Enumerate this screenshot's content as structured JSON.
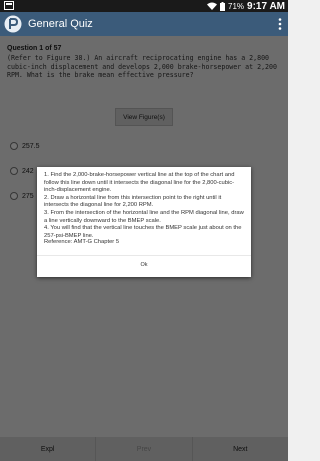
{
  "status_bar": {
    "battery_percent": "71%",
    "time": "9:17 AM"
  },
  "app_bar": {
    "title": "General Quiz"
  },
  "question": {
    "header": "Question 1 of 57",
    "text": "(Refer to Figure 38.) An aircraft reciprocating engine has a 2,800 cubic-inch displacement and develops 2,000 brake-horsepower at 2,200 RPM. What is the brake mean effective pressure?",
    "view_figure_label": "View Figure(s)",
    "options": [
      "257.5",
      "242",
      "275"
    ]
  },
  "dialog": {
    "lines": [
      "1. Find the 2,000-brake-horsepower vertical line at the top of the chart and follow this line down until it intersects the diagonal line for the 2,800-cubic-inch-displacement engine.",
      "2. Draw a horizontal line from this intersection point to the right until it intersects the diagonal line for 2,200 RPM.",
      "3. From the intersection of the horizontal line and the RPM diagonal line, draw a line vertically downward to the BMEP scale.",
      "4. You will find that the vertical line touches the BMEP scale just about on the 257-psi-BMEP line."
    ],
    "reference": "Reference: AMT-G Chapter 5",
    "ok_label": "Ok"
  },
  "bottom_bar": {
    "expl_label": "Expl",
    "prev_label": "Prev",
    "next_label": "Next"
  },
  "colors": {
    "app_bar": "#3b5b7a",
    "status_bar": "#1a1a1a"
  }
}
